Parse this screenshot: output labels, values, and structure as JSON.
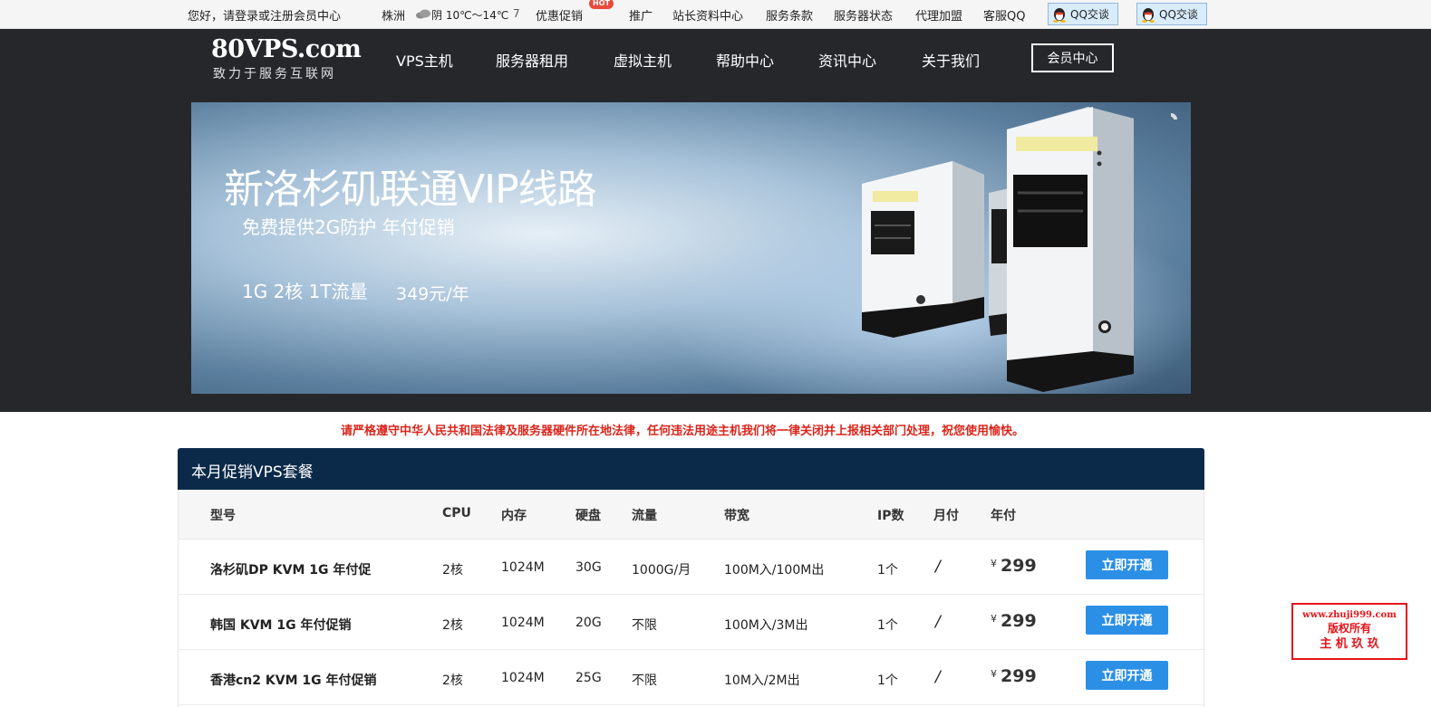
{
  "topbar": {
    "greeting": "您好，请登录或注册会员中心",
    "city": "株洲",
    "weather": "阴 10℃～14℃",
    "weather_extra": "7",
    "links": [
      "优惠促销",
      "推广",
      "站长资料中心",
      "服务条款",
      "服务器状态",
      "代理加盟",
      "客服QQ"
    ],
    "hot_badge": "HOT",
    "qq_buttons": [
      "QQ交谈",
      "QQ交谈"
    ]
  },
  "header": {
    "logo_main": "80VPS.com",
    "logo_sub": "致力于服务互联网",
    "nav": [
      "VPS主机",
      "服务器租用",
      "虚拟主机",
      "帮助中心",
      "资讯中心",
      "关于我们"
    ],
    "member_button": "会员中心"
  },
  "banner": {
    "title": "新洛杉矶联通VIP线路",
    "subtitle": "免费提供2G防护 年付促销",
    "spec": "1G 2核 1T流量",
    "price": "349元/年"
  },
  "notice": "请严格遵守中华人民共和国法律及服务器硬件所在地法律，任何违法用途主机我们将一律关闭并上报相关部门处理，祝您使用愉快。",
  "panel": {
    "title": "本月促销VPS套餐",
    "headers": [
      "型号",
      "CPU",
      "内存",
      "硬盘",
      "流量",
      "带宽",
      "IP数",
      "月付",
      "年付"
    ],
    "currency": "¥",
    "button_label": "立即开通",
    "rows": [
      {
        "name": "洛杉矶DP KVM 1G 年付促",
        "cpu": "2核",
        "ram": "1024M",
        "disk": "30G",
        "traffic": "1000G/月",
        "bandwidth": "100M入/100M出",
        "ip": "1个",
        "monthly": "/",
        "yearly": "299"
      },
      {
        "name": "韩国 KVM 1G 年付促销",
        "cpu": "2核",
        "ram": "1024M",
        "disk": "20G",
        "traffic": "不限",
        "bandwidth": "100M入/3M出",
        "ip": "1个",
        "monthly": "/",
        "yearly": "299"
      },
      {
        "name": "香港cn2 KVM 1G 年付促销",
        "cpu": "2核",
        "ram": "1024M",
        "disk": "25G",
        "traffic": "不限",
        "bandwidth": "10M入/2M出",
        "ip": "1个",
        "monthly": "/",
        "yearly": "299"
      }
    ]
  },
  "watermark": {
    "line1": "www.zhuji999.com",
    "line2": "版权所有",
    "line3": "主 机 玖 玖"
  },
  "colors": {
    "header_bg": "#25272b",
    "panel_head": "#0b2a4a",
    "button_blue": "#2c8fe6",
    "notice_red": "#d9261c"
  }
}
